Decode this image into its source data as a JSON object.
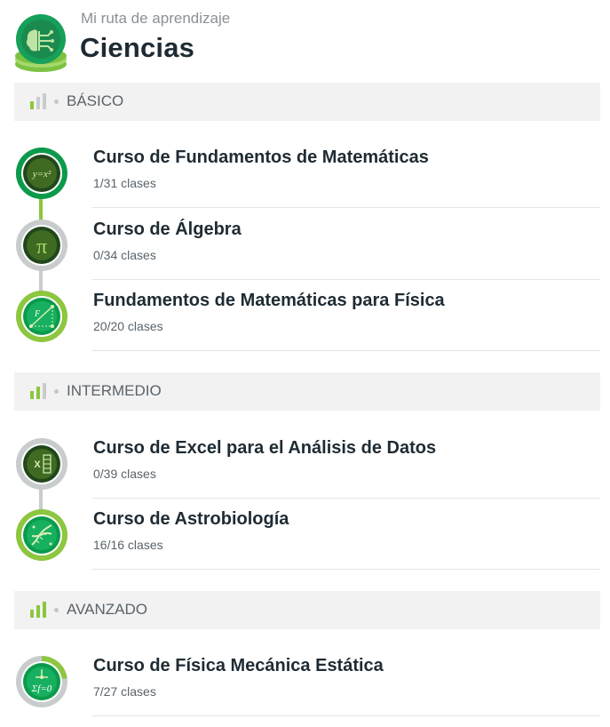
{
  "header": {
    "subtitle": "Mi ruta de aprendizaje",
    "title": "Ciencias",
    "logo_icon": "science-brain-icon"
  },
  "colors": {
    "accent_green": "#8dc63f",
    "completed_green": "#0b9a4b",
    "dark_green": "#21461c",
    "pending_gray": "#c9cccd",
    "section_bg": "#f2f2f2"
  },
  "sections": [
    {
      "label": "BÁSICO",
      "level_icon": "level-bars-basic-icon",
      "courses": [
        {
          "title": "Curso de Fundamentos de Matemáticas",
          "classes": "1/31 clases",
          "icon": "math-formula-icon",
          "progress": 0.03
        },
        {
          "title": "Curso de Álgebra",
          "classes": "0/34 clases",
          "icon": "pi-icon",
          "progress": 0.0
        },
        {
          "title": "Fundamentos de Matemáticas para Física",
          "classes": "20/20 clases",
          "icon": "vector-physics-icon",
          "progress": 1.0
        }
      ]
    },
    {
      "label": "INTERMEDIO",
      "level_icon": "level-bars-intermediate-icon",
      "courses": [
        {
          "title": "Curso de Excel para el Análisis de Datos",
          "classes": "0/39 clases",
          "icon": "excel-icon",
          "progress": 0.0
        },
        {
          "title": "Curso de Astrobiología",
          "classes": "16/16 clases",
          "icon": "dna-icon",
          "progress": 1.0
        }
      ]
    },
    {
      "label": "AVANZADO",
      "level_icon": "level-bars-advanced-icon",
      "courses": [
        {
          "title": "Curso de Física Mecánica Estática",
          "classes": "7/27 clases",
          "icon": "statics-force-icon",
          "progress": 0.26
        }
      ]
    }
  ]
}
